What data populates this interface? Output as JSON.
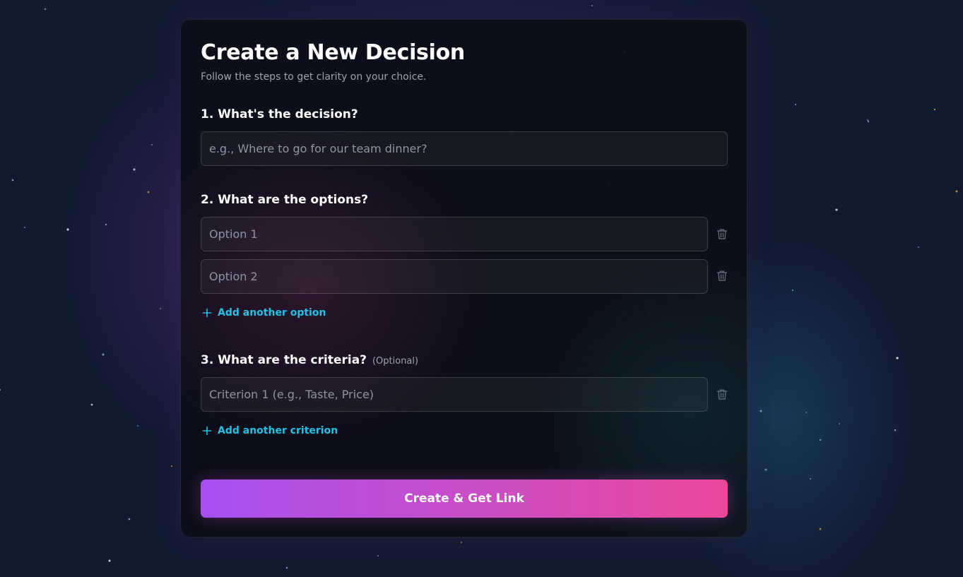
{
  "form": {
    "title": "Create a New Decision",
    "subtitle": "Follow the steps to get clarity on your choice.",
    "decision": {
      "label": "1. What's the decision?",
      "placeholder": "e.g., Where to go for our team dinner?",
      "value": ""
    },
    "options": {
      "label": "2. What are the options?",
      "items": [
        {
          "placeholder": "Option 1",
          "value": ""
        },
        {
          "placeholder": "Option 2",
          "value": ""
        }
      ],
      "add_label": "Add another option"
    },
    "criteria": {
      "label": "3. What are the criteria?",
      "optional_note": "(Optional)",
      "items": [
        {
          "placeholder": "Criterion 1 (e.g., Taste, Price)",
          "value": ""
        }
      ],
      "add_label": "Add another criterion"
    },
    "submit_label": "Create & Get Link"
  },
  "icons": {
    "delete": "trash-icon",
    "add": "plus-icon"
  },
  "colors": {
    "accent_link": "#22c3e6",
    "button_gradient_start": "#a650f0",
    "button_gradient_end": "#ec4899",
    "background": "#121a30"
  }
}
